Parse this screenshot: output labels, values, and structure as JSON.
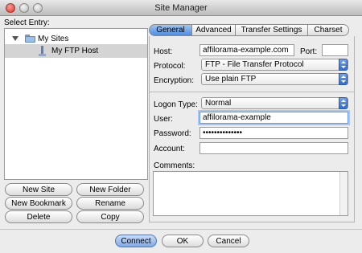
{
  "window": {
    "title": "Site Manager"
  },
  "left": {
    "select_entry_label": "Select Entry:",
    "tree": [
      {
        "label": "My Sites",
        "icon": "folder-icon"
      },
      {
        "label": "My FTP Host",
        "icon": "server-icon"
      }
    ],
    "buttons": {
      "new_site": "New Site",
      "new_folder": "New Folder",
      "new_bookmark": "New Bookmark",
      "rename": "Rename",
      "delete": "Delete",
      "copy": "Copy"
    }
  },
  "tabs": [
    "General",
    "Advanced",
    "Transfer Settings",
    "Charset"
  ],
  "active_tab": "General",
  "form": {
    "host": {
      "label": "Host:",
      "value": "affilorama-example.com"
    },
    "port": {
      "label": "Port:",
      "value": ""
    },
    "protocol": {
      "label": "Protocol:",
      "value": "FTP - File Transfer Protocol"
    },
    "encryption": {
      "label": "Encryption:",
      "value": "Use plain FTP"
    },
    "logon_type": {
      "label": "Logon Type:",
      "value": "Normal"
    },
    "user": {
      "label": "User:",
      "value": "affilorama-example"
    },
    "password": {
      "label": "Password:",
      "value": "••••••••••••••"
    },
    "account": {
      "label": "Account:",
      "value": ""
    },
    "comments": {
      "label": "Comments:",
      "value": ""
    }
  },
  "footer": {
    "connect": "Connect",
    "ok": "OK",
    "cancel": "Cancel"
  },
  "colors": {
    "accent": "#4d8ee6",
    "selection": "#d4d4d4",
    "close": "#d9342b"
  }
}
